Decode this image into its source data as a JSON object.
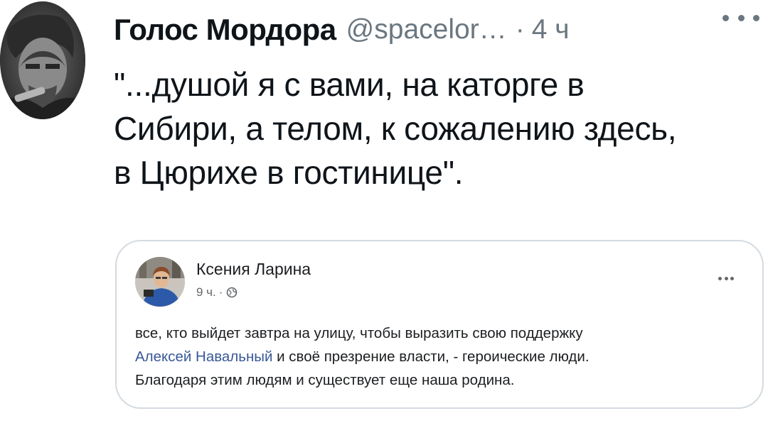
{
  "tweet": {
    "author_name": "Голос Мордора",
    "handle": "@spacelor…",
    "separator": "·",
    "time": "4 ч",
    "more_icon": "more-horizontal-icon",
    "text_lines": [
      "\"...душой я с вами, на каторге в",
      "Сибири, а телом, к сожалению здесь,",
      "в Цюрихе в гостинице\"."
    ]
  },
  "embedded_post": {
    "author_name": "Ксения Ларина",
    "time": "9 ч.",
    "separator": "·",
    "audience_icon": "globe-icon",
    "more_icon": "more-horizontal-icon",
    "line1": "все, кто выйдет завтра на улицу, чтобы выразить свою поддержку",
    "link_text": "Алексей Навальный",
    "line2_rest": " и своё презрение власти, - героические люди.",
    "line3": "Благодаря этим людям и существует еще наша родина.",
    "link_color": "#385898"
  },
  "colors": {
    "text_primary": "#0f1419",
    "text_secondary": "#6b7780",
    "card_border": "#d4dbe1"
  }
}
